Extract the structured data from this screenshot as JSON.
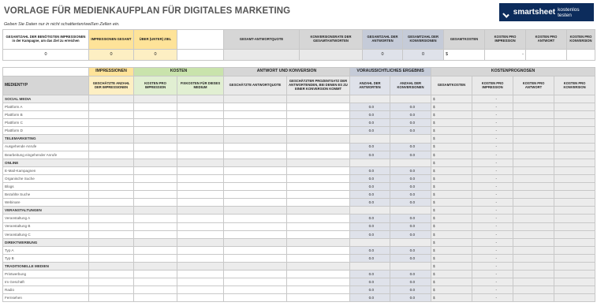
{
  "title": "VORLAGE FÜR MEDIENKAUFPLAN FÜR DIGITALES MARKETING",
  "subtitle": "Geben Sie Daten nur in nicht schattierten/weißen Zellen ein.",
  "brand": {
    "name": "smartsheet",
    "tagline": "kostenlos testen",
    "color": "#0c2c5c"
  },
  "summary": {
    "headers": [
      "GESAMTZAHL DER BENÖTIGTEN IMPRESSIONEN in der Kampagne, um das Ziel zu erreichen",
      "IMPRESSIONEN GESAMT",
      "ÜBER (UNTER) ZIEL",
      "GESAMT-ANTWORTQUOTE",
      "KONVERSIONSRATE DER GESAMTANTWORTEN",
      "GESAMTZAHL DER ANTWORTEN",
      "GESAMTZAHL DER KONVERSIONEN",
      "GESAMTKOSTEN",
      "KOSTEN PRO IMPRESSION",
      "KOSTEN PRO ANTWORT",
      "KOSTEN PRO KONVERSION"
    ],
    "values": {
      "required": "0",
      "total_impressions": "0",
      "over_under": "0",
      "answer_rate": "",
      "conversion_rate": "",
      "total_answers": "0",
      "total_conversions": "0",
      "total_cost_currency": "$",
      "total_cost_value": "-"
    }
  },
  "groups": {
    "impressions": "IMPRESSIONEN",
    "costs": "KOSTEN",
    "response": "ANTWORT UND KONVERSION",
    "result": "VORAUSSICHTLICHES ERGEBNIS",
    "forecast": "KOSTENPROGNOSEN"
  },
  "columns": {
    "media_type": "MEDIENTYP",
    "est_impressions": "GESCHÄTZTE ANZAHL DER IMPRESSIONEN",
    "cost_per_impression": "KOSTEN PRO IMPRESSION",
    "fixed_costs": "FIXKOSTEN FÜR DIESES MEDIUM",
    "est_answer_rate": "GESCHÄTZTE ANTWORTQUOTE",
    "est_conversion_pct": "GESCHÄTZTER PROZENTSATZ DER ANTWORTENDEN, BEI DENEN ES ZU EINER KONVERSION KOMMT",
    "num_answers": "ANZAHL DER ANTWORTEN",
    "num_conversions": "ANZAHL DER KONVERSIONEN",
    "total_costs": "GESAMTKOSTEN",
    "fc_per_impression": "KOSTEN PRO IMPRESSION",
    "fc_per_answer": "KOSTEN PRO ANTWORT",
    "fc_per_conversion": "KOSTEN PRO KONVERSION"
  },
  "row_values": {
    "answers": "0.0",
    "conversions": "0.0",
    "currency": "$",
    "dash": "-"
  },
  "sections": [
    {
      "name": "SOCIAL MEDIA",
      "items": [
        "Plattform A",
        "Plattform B",
        "Plattform C",
        "Plattform D"
      ]
    },
    {
      "name": "TELEMARKETING",
      "items": [
        "Ausgehende Anrufe",
        "Bearbeitung eingehender Anrufe"
      ]
    },
    {
      "name": "ONLINE",
      "items": [
        "E-Mail-Kampagnen",
        "Organische Suche",
        "Blogs",
        "Bezahlte Suche",
        "Webinare"
      ]
    },
    {
      "name": "VERANSTALTUNGEN",
      "items": [
        "Veranstaltung A",
        "Veranstaltung B",
        "Veranstaltung C"
      ]
    },
    {
      "name": "DIREKTWERBUNG",
      "items": [
        "Typ A",
        "Typ B"
      ]
    },
    {
      "name": "TRADITIONELLE MEDIEN",
      "items": [
        "Printwerbung",
        "Im Geschäft",
        "Radio",
        "Fernsehen"
      ]
    }
  ]
}
